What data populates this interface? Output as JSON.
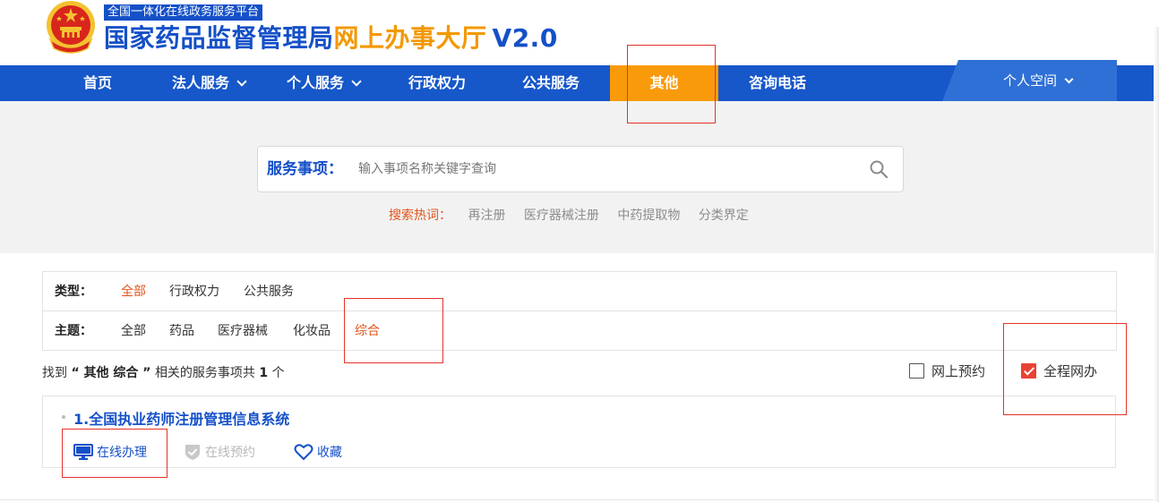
{
  "header": {
    "platform_tag": "全国一体化在线政务服务平台",
    "title_main": "国家药品监督管理局",
    "title_hall": "网上办事大厅",
    "title_version": "V2.0"
  },
  "nav": {
    "items": [
      {
        "label": "首页",
        "dropdown": false
      },
      {
        "label": "法人服务",
        "dropdown": true
      },
      {
        "label": "个人服务",
        "dropdown": true
      },
      {
        "label": "行政权力",
        "dropdown": false
      },
      {
        "label": "公共服务",
        "dropdown": false
      },
      {
        "label": "其他",
        "dropdown": false,
        "active": true
      },
      {
        "label": "咨询电话",
        "dropdown": false
      }
    ],
    "personal_space": "个人空间",
    "colors": {
      "bar": "#1657c9",
      "active": "#f99a0a",
      "personal": "#2f70d6"
    }
  },
  "search": {
    "label": "服务事项：",
    "placeholder": "输入事项名称关键字查询",
    "value": "",
    "hot_label": "搜索热词：",
    "hot_words": [
      "再注册",
      "医疗器械注册",
      "中药提取物",
      "分类界定"
    ]
  },
  "filters": {
    "type_label": "类型：",
    "type_options": [
      "全部",
      "行政权力",
      "公共服务"
    ],
    "type_selected": "全部",
    "topic_label": "主题：",
    "topic_options": [
      "全部",
      "药品",
      "医疗器械",
      "化妆品",
      "综合"
    ],
    "topic_selected": "综合"
  },
  "result": {
    "prefix": "找到",
    "keyword": "“ 其他 综合 ”",
    "middle": "相关的服务事项共",
    "count": "1",
    "suffix": "个"
  },
  "checks": {
    "online_appointment": {
      "label": "网上预约",
      "checked": false
    },
    "full_online": {
      "label": "全程网办",
      "checked": true
    }
  },
  "services": [
    {
      "title": "1.全国执业药师注册管理信息系统",
      "actions": {
        "online": "在线办理",
        "appointment": "在线预约",
        "favorite": "收藏"
      }
    }
  ],
  "icons": {
    "emblem": "national-emblem-icon",
    "search": "search-icon",
    "monitor": "monitor-icon",
    "shield": "shield-check-icon",
    "heart": "heart-icon"
  }
}
